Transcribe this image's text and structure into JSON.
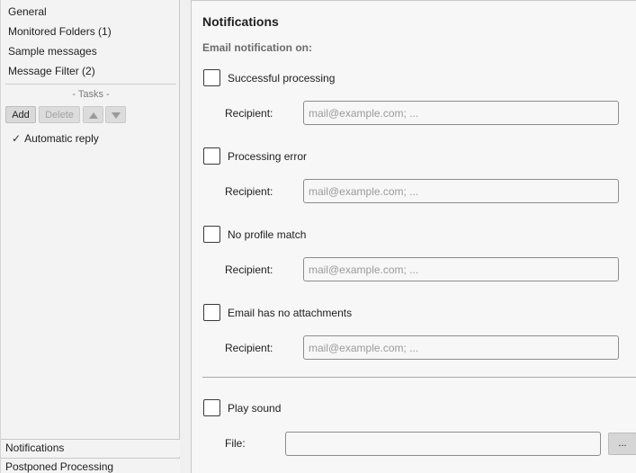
{
  "sidebar": {
    "items": [
      {
        "label": "General"
      },
      {
        "label": "Monitored Folders (1)"
      },
      {
        "label": "Sample messages"
      },
      {
        "label": "Message Filter (2)"
      }
    ],
    "tasks_caption": "- Tasks -",
    "buttons": {
      "add": "Add",
      "delete": "Delete",
      "up_icon": "arrow-up-icon",
      "down_icon": "arrow-down-icon"
    },
    "task_items": [
      {
        "check": "✓",
        "label": "Automatic reply"
      }
    ],
    "bottom_tabs": [
      {
        "label": "Notifications"
      },
      {
        "label": "Postponed Processing"
      }
    ]
  },
  "main": {
    "title": "Notifications",
    "section_label": "Email notification on:",
    "notifications": [
      {
        "label": "Successful processing",
        "checked": false,
        "recipient_label": "Recipient:",
        "placeholder": "mail@example.com; ...",
        "value": ""
      },
      {
        "label": "Processing error",
        "checked": false,
        "recipient_label": "Recipient:",
        "placeholder": "mail@example.com; ...",
        "value": ""
      },
      {
        "label": "No profile match",
        "checked": false,
        "recipient_label": "Recipient:",
        "placeholder": "mail@example.com; ...",
        "value": ""
      },
      {
        "label": "Email has no attachments",
        "checked": false,
        "recipient_label": "Recipient:",
        "placeholder": "mail@example.com; ...",
        "value": ""
      }
    ],
    "sound": {
      "label": "Play sound",
      "checked": false,
      "file_label": "File:",
      "file_value": "",
      "browse_label": "..."
    }
  },
  "colors": {
    "panel_bg": "#f7f7f7",
    "sidebar_bg": "#f3f3f3",
    "border": "#c8c8c8"
  }
}
